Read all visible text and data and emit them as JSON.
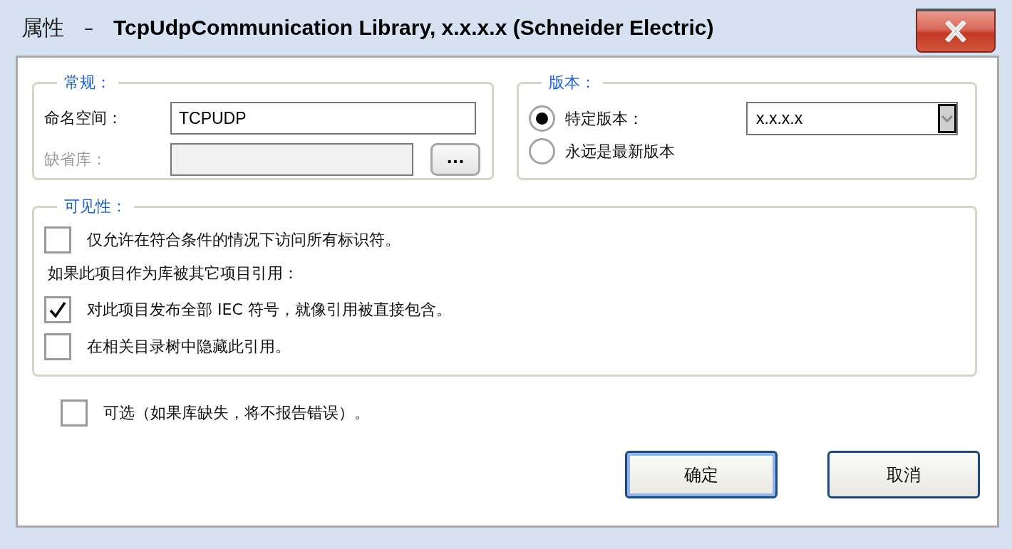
{
  "window": {
    "title_prefix": "属性",
    "title_separator": "–",
    "title": "TcpUdpCommunication Library, x.x.x.x (Schneider Electric)"
  },
  "general": {
    "legend": "常规：",
    "fields": [
      {
        "label": "命名空间：",
        "value": "TCPUDP",
        "disabled": false
      },
      {
        "label": "缺省库：",
        "disabled": true,
        "browse_button": "..."
      }
    ]
  },
  "version": {
    "legend": "版本：",
    "options": [
      {
        "label": "特定版本：",
        "selected": true
      },
      {
        "label": "永远是最新版本",
        "selected": false
      }
    ],
    "dropdown": {
      "value": "x.x.x.x"
    }
  },
  "visibility": {
    "legend": "可见性：",
    "items": [
      {
        "kind": "checkbox",
        "label": "仅允许在符合条件的情况下访问所有标识符。",
        "checked": false
      },
      {
        "kind": "note",
        "label": "如果此项目作为库被其它项目引用："
      },
      {
        "kind": "checkbox",
        "label": "对此项目发布全部 IEC 符号，就像引用被直接包含。",
        "checked": true
      },
      {
        "kind": "checkbox",
        "label": "在相关目录树中隐藏此引用。",
        "checked": false
      }
    ]
  },
  "optional": {
    "label": "可选（如果库缺失，将不报告错误）。",
    "checked": false
  },
  "buttons": [
    {
      "label": "确定",
      "default": true
    },
    {
      "label": "取消",
      "default": false
    }
  ]
}
